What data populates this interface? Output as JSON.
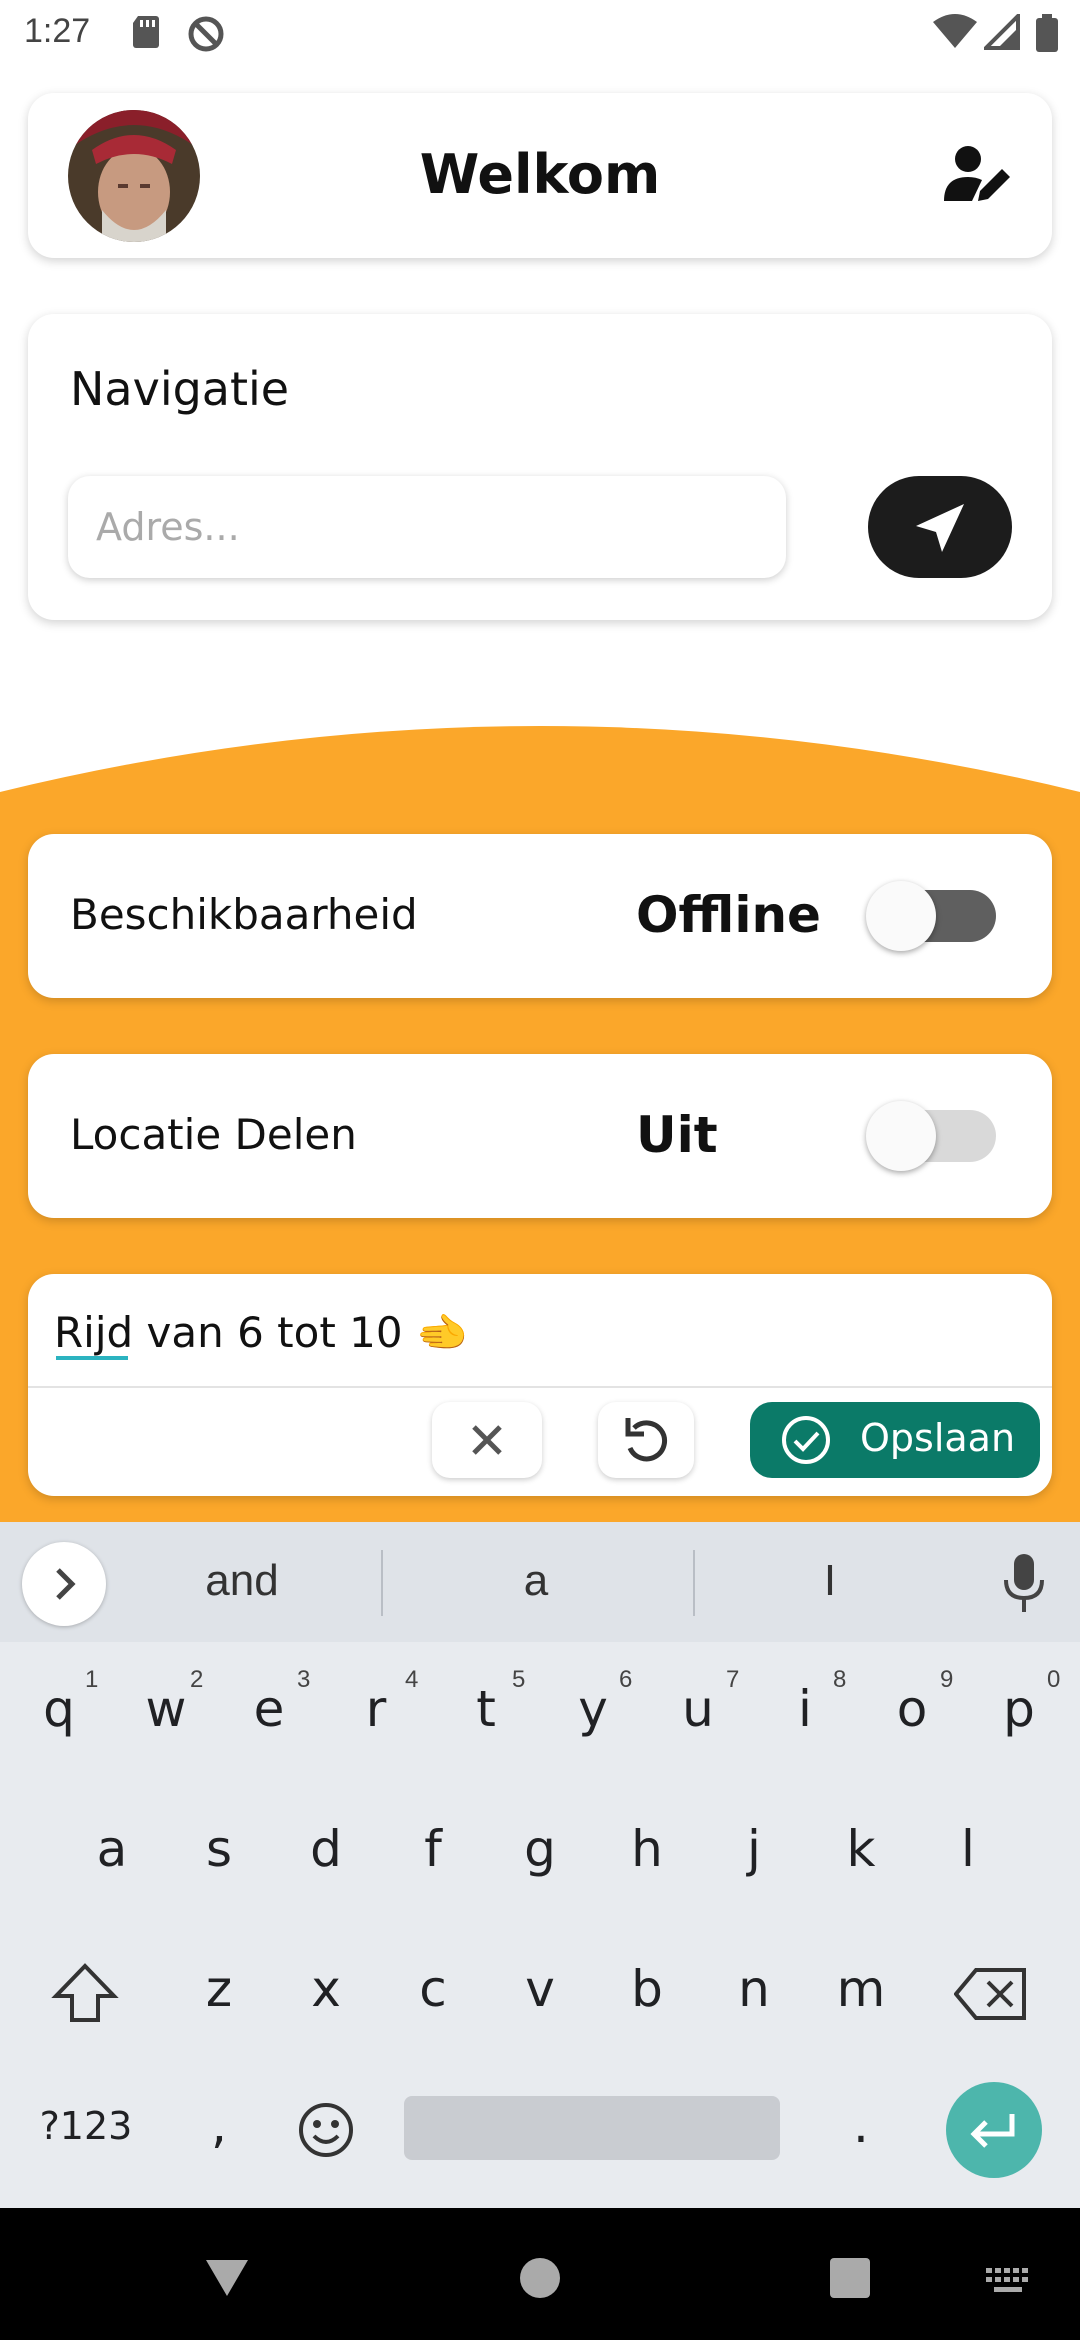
{
  "status_bar": {
    "time": "1:27",
    "icons": [
      "sd-card-icon",
      "no-disturb-icon",
      "wifi-icon",
      "signal-icon",
      "battery-icon"
    ]
  },
  "header": {
    "title": "Welkom",
    "avatar": "avatar",
    "edit_icon": "edit-profile-icon"
  },
  "navigation": {
    "title": "Navigatie",
    "address_placeholder": "Adres...",
    "navigate_icon": "navigation-arrow-icon"
  },
  "availability": {
    "label": "Beschikbaarheid",
    "state": "Offline",
    "enabled": false
  },
  "location_sharing": {
    "label": "Locatie Delen",
    "state": "Uit",
    "enabled": false
  },
  "note": {
    "text": "Rijd van 6 tot 10 🫲",
    "cancel_icon": "close-icon",
    "undo_icon": "undo-icon",
    "save_label": "Opslaan"
  },
  "keyboard": {
    "suggestions": [
      "and",
      "a",
      "I"
    ],
    "row1": [
      "q",
      "w",
      "e",
      "r",
      "t",
      "y",
      "u",
      "i",
      "o",
      "p"
    ],
    "row1_hints": [
      "1",
      "2",
      "3",
      "4",
      "5",
      "6",
      "7",
      "8",
      "9",
      "0"
    ],
    "row2": [
      "a",
      "s",
      "d",
      "f",
      "g",
      "h",
      "j",
      "k",
      "l"
    ],
    "row3": [
      "z",
      "x",
      "c",
      "v",
      "b",
      "n",
      "m"
    ],
    "symbols_label": "?123",
    "comma": ",",
    "period": "."
  },
  "colors": {
    "accent_orange": "#FBA72A",
    "save_green": "#0b7a68",
    "enter_teal": "#4db6ac",
    "toggle_track_dark": "#5f5f5f",
    "toggle_track_light": "#bdbdbd"
  }
}
